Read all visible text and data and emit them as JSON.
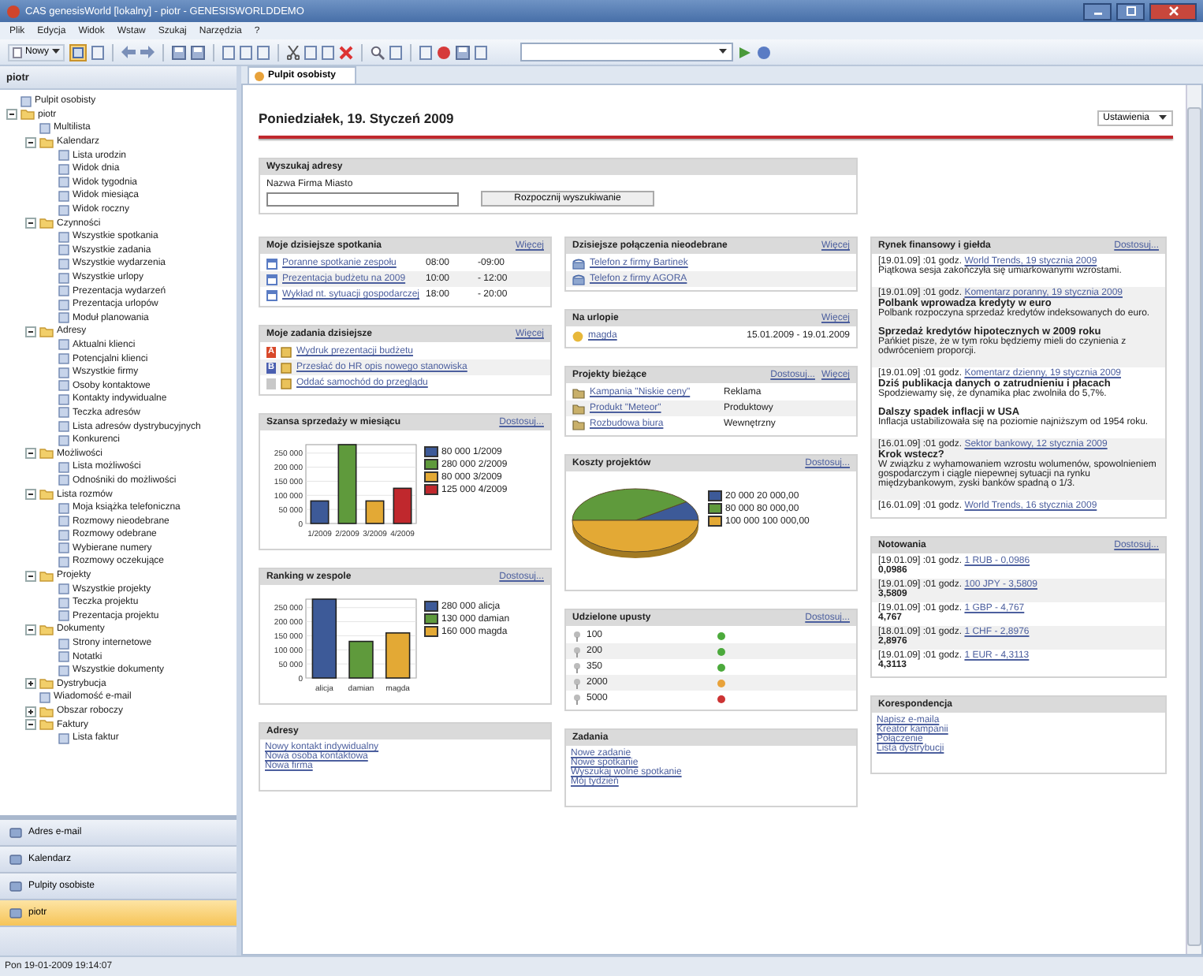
{
  "window": {
    "title": "CAS genesisWorld [lokalny] - piotr - GENESISWORLDDEMO"
  },
  "menu": [
    "Plik",
    "Edycja",
    "Widok",
    "Wstaw",
    "Szukaj",
    "Narzędzia",
    "?"
  ],
  "toolbar": {
    "new_button": "Nowy"
  },
  "sidebar": {
    "header": "piotr",
    "tree": [
      {
        "label": "Pulpit osobisty"
      },
      {
        "label": "piotr",
        "expanded": true,
        "children": [
          {
            "label": "Multilista"
          },
          {
            "label": "Kalendarz",
            "expanded": true,
            "children": [
              {
                "label": "Lista urodzin"
              },
              {
                "label": "Widok dnia"
              },
              {
                "label": "Widok tygodnia"
              },
              {
                "label": "Widok miesiąca"
              },
              {
                "label": "Widok roczny"
              }
            ]
          },
          {
            "label": "Czynności",
            "expanded": true,
            "children": [
              {
                "label": "Wszystkie spotkania"
              },
              {
                "label": "Wszystkie zadania"
              },
              {
                "label": "Wszystkie wydarzenia"
              },
              {
                "label": "Wszystkie urlopy"
              },
              {
                "label": "Prezentacja wydarzeń"
              },
              {
                "label": "Prezentacja urlopów"
              },
              {
                "label": "Moduł planowania"
              }
            ]
          },
          {
            "label": "Adresy",
            "expanded": true,
            "children": [
              {
                "label": "Aktualni klienci"
              },
              {
                "label": "Potencjalni klienci"
              },
              {
                "label": "Wszystkie firmy"
              },
              {
                "label": "Osoby kontaktowe"
              },
              {
                "label": "Kontakty indywidualne"
              },
              {
                "label": "Teczka adresów"
              },
              {
                "label": "Lista adresów dystrybucyjnych"
              },
              {
                "label": "Konkurenci"
              }
            ]
          },
          {
            "label": "Możliwości",
            "expanded": true,
            "children": [
              {
                "label": "Lista możliwości"
              },
              {
                "label": "Odnośniki do możliwości"
              }
            ]
          },
          {
            "label": "Lista rozmów",
            "expanded": true,
            "children": [
              {
                "label": "Moja książka telefoniczna"
              },
              {
                "label": "Rozmowy nieodebrane"
              },
              {
                "label": "Rozmowy odebrane"
              },
              {
                "label": "Wybierane numery"
              },
              {
                "label": "Rozmowy oczekujące"
              }
            ]
          },
          {
            "label": "Projekty",
            "expanded": true,
            "children": [
              {
                "label": "Wszystkie projekty"
              },
              {
                "label": "Teczka projektu"
              },
              {
                "label": "Prezentacja projektu"
              }
            ]
          },
          {
            "label": "Dokumenty",
            "expanded": true,
            "children": [
              {
                "label": "Strony internetowe"
              },
              {
                "label": "Notatki"
              },
              {
                "label": "Wszystkie dokumenty"
              }
            ]
          },
          {
            "label": "Dystrybucja",
            "expanded": false
          },
          {
            "label": "Wiadomość e-mail"
          },
          {
            "label": "Obszar roboczy",
            "expanded": false
          },
          {
            "label": "Faktury",
            "expanded": true,
            "children": [
              {
                "label": "Lista faktur"
              }
            ]
          }
        ]
      }
    ],
    "nav": [
      {
        "label": "Adres e-mail",
        "selected": false
      },
      {
        "label": "Kalendarz",
        "selected": false
      },
      {
        "label": "Pulpity osobiste",
        "selected": false
      },
      {
        "label": "piotr",
        "selected": true
      }
    ]
  },
  "tabs": [
    {
      "label": "Pulpit osobisty",
      "selected": true
    }
  ],
  "dashboard": {
    "date": "Poniedziałek, 19. Styczeń 2009",
    "settings": "Ustawienia",
    "search": {
      "title": "Wyszukaj adresy",
      "label": "Nazwa Firma Miasto",
      "button": "Rozpocznij wyszukiwanie"
    },
    "columns": [
      [
        {
          "kind": "meetings",
          "title": "Moje dzisiejsze spotkania",
          "links": [
            "Więcej"
          ],
          "rows": [
            {
              "title": "Poranne spotkanie zespołu",
              "start": "08:00",
              "end": "-09:00"
            },
            {
              "title": "Prezentacja budżetu na 2009",
              "start": "10:00",
              "end": "- 12:00"
            },
            {
              "title": "Wykład nt. sytuacji gospodarczej",
              "start": "18:00",
              "end": "- 20:00"
            }
          ]
        },
        {
          "kind": "tasks",
          "title": "Moje zadania dzisiejsze",
          "links": [
            "Więcej"
          ],
          "rows": [
            {
              "priority": "A",
              "color": "#d8482a",
              "title": "Wydruk prezentacji budżetu"
            },
            {
              "priority": "B",
              "color": "#4a5fb0",
              "title": "Przesłać do HR opis nowego stanowiska"
            },
            {
              "color": "#c8c8c8",
              "title": "Oddać samochód do przeglądu"
            }
          ]
        },
        {
          "kind": "chart",
          "title": "Szansa sprzedaży w miesiącu",
          "links": [
            "Dostosuj..."
          ],
          "chart_data": {
            "type": "bar",
            "grid": true,
            "categories": [
              "1/2009",
              "2/2009",
              "3/2009",
              "4/2009"
            ],
            "values": [
              80000,
              280000,
              80000,
              125000
            ],
            "ylim": [
              0,
              280000
            ],
            "yticks": [
              {
                "value": 0,
                "label": "0"
              },
              {
                "value": 50000,
                "label": "50 000"
              },
              {
                "value": 100000,
                "label": "100 000"
              },
              {
                "value": 150000,
                "label": "150 000"
              },
              {
                "value": 200000,
                "label": "200 000"
              },
              {
                "value": 250000,
                "label": "250 000"
              }
            ]
          },
          "legend": [
            {
              "label": "80 000 1/2009",
              "color": "#3d5a98"
            },
            {
              "label": "280 000 2/2009",
              "color": "#5f9a3c"
            },
            {
              "label": "80 000 3/2009",
              "color": "#e3a935"
            },
            {
              "label": "125 000 4/2009",
              "color": "#c0282d"
            }
          ]
        },
        {
          "kind": "chart",
          "title": "Ranking w zespole",
          "links": [
            "Dostosuj..."
          ],
          "chart_data": {
            "type": "bar",
            "grid": true,
            "categories": [
              "alicja",
              "damian",
              "magda"
            ],
            "values": [
              280000,
              130000,
              160000
            ],
            "ylim": [
              0,
              280000
            ],
            "yticks": [
              {
                "value": 0,
                "label": "0"
              },
              {
                "value": 50000,
                "label": "50 000"
              },
              {
                "value": 100000,
                "label": "100 000"
              },
              {
                "value": 150000,
                "label": "150 000"
              },
              {
                "value": 200000,
                "label": "200 000"
              },
              {
                "value": 250000,
                "label": "250 000"
              }
            ]
          },
          "legend": [
            {
              "label": "280 000 alicja",
              "color": "#3d5a98"
            },
            {
              "label": "130 000 damian",
              "color": "#5f9a3c"
            },
            {
              "label": "160 000 magda",
              "color": "#e3a935"
            }
          ]
        },
        {
          "kind": "links",
          "title": "Adresy",
          "items": [
            "Nowy kontakt indywidualny",
            "Nowa osoba kontaktowa",
            "Nowa firma"
          ]
        }
      ],
      [
        {
          "kind": "calls",
          "title": "Dzisiejsze połączenia nieodebrane",
          "links": [
            "Więcej"
          ],
          "rows": [
            {
              "title": "Telefon z firmy Bartinek"
            },
            {
              "title": "Telefon z firmy AGORA"
            }
          ]
        },
        {
          "kind": "vacation",
          "title": "Na urlopie",
          "links": [
            "Więcej"
          ],
          "rows": [
            {
              "name": "magda",
              "dates": "15.01.2009 - 19.01.2009"
            }
          ]
        },
        {
          "kind": "projects",
          "title": "Projekty bieżące",
          "links": [
            "Dostosuj...",
            "Więcej"
          ],
          "rows": [
            {
              "title": "Kampania \"Niskie ceny\"",
              "type": "Reklama"
            },
            {
              "title": "Produkt \"Meteor\"",
              "type": "Produktowy"
            },
            {
              "title": "Rozbudowa biura",
              "type": "Wewnętrzny"
            }
          ]
        },
        {
          "kind": "pie",
          "title": "Koszty projektów",
          "links": [
            "Dostosuj..."
          ],
          "chart_data": {
            "type": "pie",
            "values": [
              10,
              40,
              50
            ]
          },
          "legend": [
            {
              "label": "20 000 20 000,00",
              "color": "#3d5a98"
            },
            {
              "label": "80 000 80 000,00",
              "color": "#5f9a3c"
            },
            {
              "label": "100 000 100 000,00",
              "color": "#e3a935"
            }
          ]
        },
        {
          "kind": "discounts",
          "title": "Udzielone upusty",
          "links": [
            "Dostosuj..."
          ],
          "rows": [
            {
              "value": "100",
              "color": "#4caa3c"
            },
            {
              "value": "200",
              "color": "#4caa3c"
            },
            {
              "value": "350",
              "color": "#4caa3c"
            },
            {
              "value": "2000",
              "color": "#e8a23a"
            },
            {
              "value": "5000",
              "color": "#cc3333"
            }
          ]
        },
        {
          "kind": "links",
          "title": "Zadania",
          "items": [
            "Nowe zadanie",
            "Nowe spotkanie",
            "Wyszukaj wolne spotkanie",
            "Mój tydzień"
          ]
        }
      ],
      [
        {
          "kind": "news",
          "title": "Rynek finansowy i giełda",
          "links": [
            "Dostosuj..."
          ],
          "items": [
            {
              "meta": "[19.01.09] :01 godz.",
              "link": "World Trends, 19 stycznia 2009",
              "paragraphs": [
                {
                  "body": "Piątkowa sesja zakończyła się umiarkowanymi wzrostami."
                }
              ]
            },
            {
              "meta": "[19.01.09] :01 godz.",
              "link": "Komentarz poranny, 19 stycznia 2009",
              "paragraphs": [
                {
                  "title": "Polbank wprowadza kredyty w euro",
                  "body": "Polbank rozpoczyna sprzedaż kredytów indeksowanych do euro."
                },
                {
                  "title": "Sprzedaż kredytów hipotecznych w 2009 roku",
                  "body": "Pańkiet pisze, że w tym roku będziemy mieli do czynienia z odwróceniem proporcji."
                }
              ]
            },
            {
              "meta": "[19.01.09] :01 godz.",
              "link": "Komentarz dzienny, 19 stycznia 2009",
              "paragraphs": [
                {
                  "title": "Dziś publikacja danych o zatrudnieniu i płacach",
                  "body": "Spodziewamy się, że dynamika płac zwolniła do 5,7%."
                },
                {
                  "title": "Dalszy spadek inflacji w USA",
                  "body": "Inflacja ustabilizowała się na poziomie najniższym od 1954 roku."
                }
              ]
            },
            {
              "meta": "[16.01.09] :01 godz.",
              "link": "Sektor bankowy, 12 stycznia 2009",
              "paragraphs": [
                {
                  "title": "Krok wstecz?",
                  "body": "W związku z wyhamowaniem wzrostu wolumenów, spowolnieniem gospodarczym i ciągle niepewnej sytuacji na rynku międzybankowym, zyski banków spadną o 1/3."
                }
              ]
            },
            {
              "meta": "[16.01.09] :01 godz.",
              "link": "World Trends, 16 stycznia 2009"
            }
          ]
        },
        {
          "kind": "quotes",
          "title": "Notowania",
          "links": [
            "Dostosuj..."
          ],
          "rows": [
            {
              "meta": "[19.01.09] :01 godz.",
              "link": "1 RUB - 0,0986",
              "value": "0,0986"
            },
            {
              "meta": "[19.01.09] :01 godz.",
              "link": "100 JPY - 3,5809",
              "value": "3,5809"
            },
            {
              "meta": "[19.01.09] :01 godz.",
              "link": "1 GBP - 4,767",
              "value": "4,767"
            },
            {
              "meta": "[18.01.09] :01 godz.",
              "link": "1 CHF - 2,8976",
              "value": "2,8976"
            },
            {
              "meta": "[19.01.09] :01 godz.",
              "link": "1 EUR - 4,3113",
              "value": "4,3113"
            }
          ]
        },
        {
          "kind": "links",
          "title": "Korespondencja",
          "items": [
            "Napisz e-maila",
            "Kreator kampanii",
            "Połączenie",
            "Lista dystrybucji"
          ]
        }
      ]
    ]
  },
  "status_bar": "Pon 19-01-2009 19:14:07"
}
